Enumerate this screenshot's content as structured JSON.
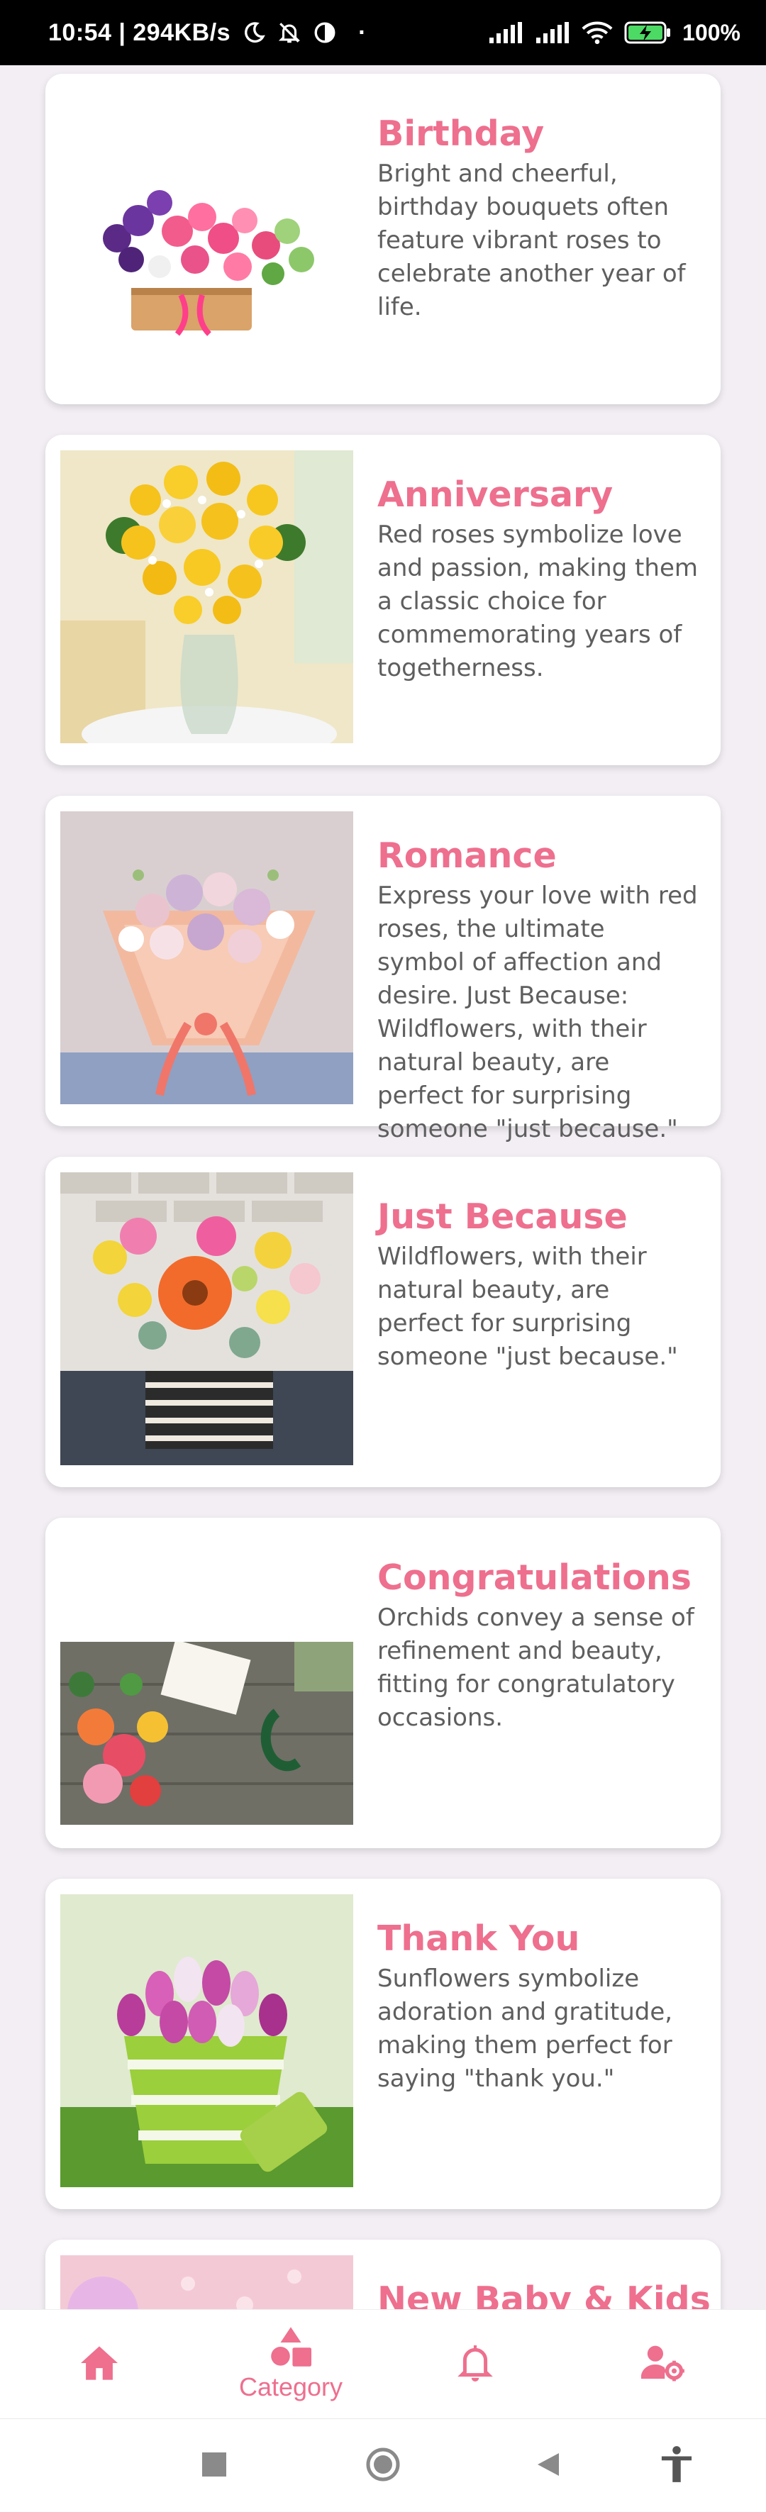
{
  "status_bar": {
    "time_speed": "10:54 | 294KB/s",
    "dot": "·",
    "battery_percent": "100%",
    "icons": [
      "moon-icon",
      "bell-off-icon",
      "contrast-icon",
      "signal-icon",
      "signal-icon",
      "wifi-icon",
      "battery-charging-icon"
    ]
  },
  "cards": [
    {
      "title": "Birthday",
      "description": "Bright and cheerful, birthday bouquets often feature vibrant roses to celebrate another year of life.",
      "image": "birthday-bouquet-image"
    },
    {
      "title": "Anniversary",
      "description": "Red roses symbolize love and passion, making them a classic choice for commemorating years of togetherness.",
      "image": "anniversary-bouquet-image"
    },
    {
      "title": "Romance",
      "description": "Express your love with red roses, the ultimate symbol of affection and desire. Just Because: Wildflowers, with their natural beauty, are perfect for surprising someone \"just because.\"",
      "image": "romance-bouquet-image"
    },
    {
      "title": "Just Because",
      "description": "Wildflowers, with their natural beauty, are perfect for surprising someone \"just because.\"",
      "image": "just-because-bouquet-image"
    },
    {
      "title": "Congratulations",
      "description": "Orchids convey a sense of refinement and beauty, fitting for congratulatory occasions.",
      "image": "congratulations-bouquet-image"
    },
    {
      "title": "Thank You",
      "description": "Sunflowers symbolize adoration and gratitude, making them perfect for saying \"thank you.\"",
      "image": "thank-you-bouquet-image"
    },
    {
      "title": "New Baby & Kids",
      "description": "",
      "image": "new-baby-bouquet-image"
    }
  ],
  "bottom_nav": {
    "items": [
      {
        "icon": "home-icon",
        "label": ""
      },
      {
        "icon": "category-icon",
        "label": "Category"
      },
      {
        "icon": "bell-icon",
        "label": ""
      },
      {
        "icon": "user-settings-icon",
        "label": ""
      }
    ]
  },
  "colors": {
    "accent": "#ee6f8e",
    "background": "#f2eef4",
    "card": "#ffffff",
    "text": "#5e5e5e"
  }
}
